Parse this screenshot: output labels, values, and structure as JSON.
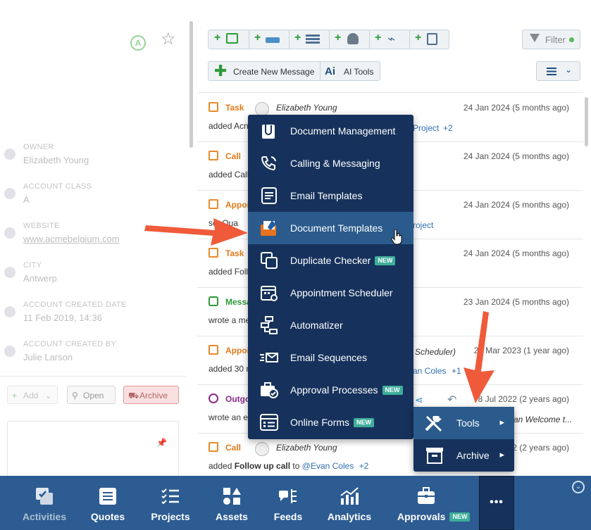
{
  "left_panel": {
    "fields": [
      {
        "label": "OWNER",
        "value": "Elizabeth Young"
      },
      {
        "label": "ACCOUNT CLASS",
        "value": "A"
      },
      {
        "label": "WEBSITE",
        "value": "www.acmebelgium.com"
      },
      {
        "label": "CITY",
        "value": "Antwerp"
      },
      {
        "label": "ACCOUNT CREATED DATE",
        "value": "11 Feb 2019, 14:36"
      },
      {
        "label": "ACCOUNT CREATED BY",
        "value": "Julie Larson"
      }
    ],
    "class_badge": "A",
    "buttons": {
      "add": "Add",
      "open": "Open",
      "archive": "Archive"
    }
  },
  "toolbar": {
    "filter_label": "Filter",
    "create_message": "Create New Message",
    "ai_tools": "AI Tools",
    "ai_icon_text": "Ai"
  },
  "feed": [
    {
      "type": "Task",
      "type_color": "#e07b1a",
      "person": "Elizabeth Young",
      "date": "24 Jan 2024 (5 months ago)",
      "text": "added Acn",
      "tail": "Project",
      "tail_count": "+2"
    },
    {
      "type": "Call",
      "type_color": "#e07b1a",
      "person": "",
      "date": "24 Jan 2024 (5 months ago)",
      "text": "added Call",
      "tail": "",
      "tail_count": ""
    },
    {
      "type": "Appoi",
      "type_color": "#e07b1a",
      "person": "",
      "date": "24 Jan 2024 (5 months ago)",
      "text": "set Qua",
      "tail": "roject",
      "tail_count": ""
    },
    {
      "type": "Task",
      "type_color": "#e07b1a",
      "person": "",
      "date": "24 Jan 2024 (5 months ago)",
      "text": "added Foll",
      "tail": "",
      "tail_count": ""
    },
    {
      "type": "Messa",
      "type_color": "#2e9a3a",
      "person": "",
      "date": "23 Jan 2024 (5 months ago)",
      "text": "wrote a me",
      "tail": "",
      "tail_count": ""
    },
    {
      "type": "Appoi",
      "type_color": "#e07b1a",
      "person": "",
      "date": "27 Mar 2023 (1 year ago)",
      "text": "added 30 n",
      "tail": "an Coles",
      "tail_count": "+1",
      "mid": "Scheduler)"
    },
    {
      "type": "Outgo",
      "type_color": "#8a2a8a",
      "person": "",
      "date": "8 Jul 2022 (2 years ago)",
      "text": "wrote an e",
      "tail": "an Welcome t...",
      "tail_count": ""
    },
    {
      "type": "Call",
      "type_color": "#e07b1a",
      "person": "Elizabeth Young",
      "date": "2 (2 years ago)",
      "text": "added",
      "bold": "Follow up call",
      "to": "to",
      "link": "@Evan Coles",
      "tail_count": "+2"
    }
  ],
  "menu": {
    "items": [
      {
        "label": "Document Management",
        "badge": "",
        "icon": "paperclip-document-icon"
      },
      {
        "label": "Calling & Messaging",
        "badge": "",
        "icon": "phone-icon"
      },
      {
        "label": "Email Templates",
        "badge": "",
        "icon": "email-template-icon"
      },
      {
        "label": "Document Templates",
        "badge": "",
        "icon": "document-template-icon"
      },
      {
        "label": "Duplicate Checker",
        "badge": "NEW",
        "icon": "duplicate-icon"
      },
      {
        "label": "Appointment Scheduler",
        "badge": "",
        "icon": "calendar-link-icon"
      },
      {
        "label": "Automatizer",
        "badge": "",
        "icon": "workflow-icon"
      },
      {
        "label": "Email Sequences",
        "badge": "",
        "icon": "email-sequence-icon"
      },
      {
        "label": "Approval Processes",
        "badge": "NEW",
        "icon": "briefcase-check-icon"
      },
      {
        "label": "Online Forms",
        "badge": "NEW",
        "icon": "form-icon"
      }
    ],
    "hover_index": 3
  },
  "submenu": {
    "items": [
      {
        "label": "Tools",
        "icon": "tools-icon"
      },
      {
        "label": "Archive",
        "icon": "archive-icon"
      }
    ]
  },
  "bottom_nav": {
    "items": [
      {
        "label": "Activities",
        "icon": "activities-icon"
      },
      {
        "label": "Quotes",
        "icon": "quotes-icon"
      },
      {
        "label": "Projects",
        "icon": "projects-icon"
      },
      {
        "label": "Assets",
        "icon": "assets-icon"
      },
      {
        "label": "Feeds",
        "icon": "feeds-icon"
      },
      {
        "label": "Analytics",
        "icon": "analytics-icon"
      },
      {
        "label": "Approvals",
        "icon": "approvals-icon",
        "badge": "NEW"
      }
    ],
    "more_label": "•••"
  },
  "colors": {
    "menu_bg": "#16325c",
    "menu_hover": "#2b5b8c",
    "bottom_bar": "#2d5c92",
    "badge_new": "#3fae9a",
    "arrow": "#ef5b3a"
  }
}
